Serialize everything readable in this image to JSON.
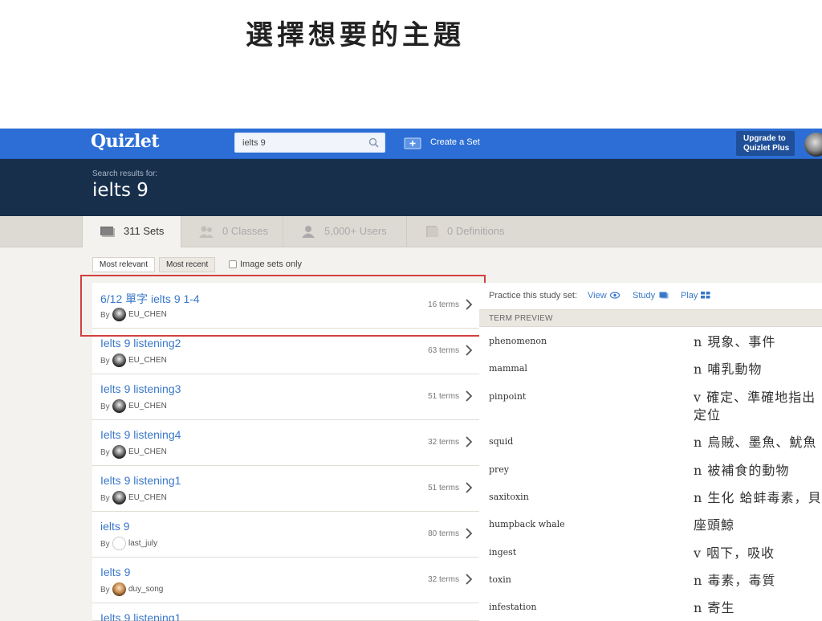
{
  "slide_title": "選擇想要的主題",
  "topbar": {
    "logo": "Quizlet",
    "search_value": "ielts 9",
    "create_set_label": "Create a Set",
    "upgrade_line1": "Upgrade to",
    "upgrade_line2": "Quizlet Plus"
  },
  "header": {
    "search_results_for": "Search results for:",
    "query": "ielts 9"
  },
  "tabs": [
    {
      "label": "311 Sets",
      "icon": "sets-icon",
      "active": true
    },
    {
      "label": "0 Classes",
      "icon": "classes-icon",
      "active": false
    },
    {
      "label": "5,000+ Users",
      "icon": "user-icon",
      "active": false
    },
    {
      "label": "0 Definitions",
      "icon": "definitions-icon",
      "active": false
    }
  ],
  "sort": {
    "most_relevant": "Most relevant",
    "most_recent": "Most recent",
    "image_sets_only": "Image sets only"
  },
  "sets": [
    {
      "title": "6/12 單字 ielts 9 1-4",
      "by": "By",
      "user": "EU_CHEN",
      "terms": "16 terms"
    },
    {
      "title": "Ielts 9 listening2",
      "by": "By",
      "user": "EU_CHEN",
      "terms": "63 terms"
    },
    {
      "title": "Ielts 9 listening3",
      "by": "By",
      "user": "EU_CHEN",
      "terms": "51 terms"
    },
    {
      "title": "Ielts 9 listening4",
      "by": "By",
      "user": "EU_CHEN",
      "terms": "32 terms"
    },
    {
      "title": "Ielts 9 listening1",
      "by": "By",
      "user": "EU_CHEN",
      "terms": "51 terms"
    },
    {
      "title": "ielts 9",
      "by": "By",
      "user": "last_july",
      "terms": "80 terms"
    },
    {
      "title": "Ielts 9",
      "by": "By",
      "user": "duy_song",
      "terms": "32 terms"
    },
    {
      "title": "Ielts 9 listening1",
      "by": "By",
      "user": "",
      "terms": ""
    }
  ],
  "preview": {
    "practice_label": "Practice this study set:",
    "view": "View",
    "study": "Study",
    "play": "Play",
    "term_preview_header": "TERM PREVIEW",
    "terms": [
      {
        "term": "phenomenon",
        "def": "n 現象、事件"
      },
      {
        "term": "mammal",
        "def": "n 哺乳動物"
      },
      {
        "term": "pinpoint",
        "def": "v 確定、準確地指出定位"
      },
      {
        "term": "squid",
        "def": "n 烏賊、墨魚、魷魚"
      },
      {
        "term": "prey",
        "def": "n 被補食的動物"
      },
      {
        "term": "saxitoxin",
        "def": "n 生化 蛤蚌毒素，貝"
      },
      {
        "term": "humpback whale",
        "def": "座頭鯨"
      },
      {
        "term": "ingest",
        "def": "v 咽下，吸收"
      },
      {
        "term": "toxin",
        "def": "n 毒素，毒質"
      },
      {
        "term": "infestation",
        "def": "n 寄生"
      }
    ]
  },
  "colors": {
    "topbar": "#2c6ed5",
    "header": "#172f4b",
    "link": "#3a78c9",
    "highlight": "#d24040"
  }
}
